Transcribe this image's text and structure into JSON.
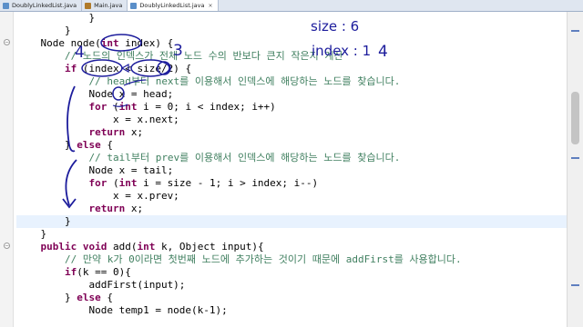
{
  "tabs": [
    {
      "label": "DoublyLinkedList.java",
      "active": false
    },
    {
      "label": "Main.java",
      "active": false
    },
    {
      "label": "DoublyLinkedList.java",
      "active": true
    }
  ],
  "close_glyph": "×",
  "code": {
    "l0": "            }",
    "l1a": "        }",
    "l2_pre": "    Node node(",
    "l2_kw": "int",
    "l2_post": " index) {",
    "l3": "        // 노드의 인덱스가 전체 노드 수의 반보다 큰지 작은지 계산",
    "l4_kw": "if",
    "l4_post": " (index < size/2) {",
    "l5": "            // head부터 next를 이용해서 인덱스에 해당하는 노드를 찾습니다.",
    "l6": "            Node x = head;",
    "l7_kw": "for",
    "l7_mid": " (",
    "l7_kw2": "int",
    "l7_post": " i = 0; i < index; i++)",
    "l8": "                x = x.next;",
    "l9_kw": "return",
    "l9_post": " x;",
    "l10_pre": "        } ",
    "l10_kw": "else",
    "l10_post": " {",
    "l11": "            // tail부터 prev를 이용해서 인덱스에 해당하는 노드를 찾습니다.",
    "l12": "            Node x = tail;",
    "l13_kw": "for",
    "l13_mid": " (",
    "l13_kw2": "int",
    "l13_post": " i = size - 1; i > index; i--)",
    "l14": "                x = x.prev;",
    "l15_kw": "return",
    "l15_post": " x;",
    "l16": "        }",
    "l17": "    }",
    "l18_kw1": "public",
    "l18_kw2": "void",
    "l18_mid": " add(",
    "l18_kw3": "int",
    "l18_post": " k, Object input){",
    "l19": "        // 만약 k가 0이라면 첫번째 노드에 추가하는 것이기 때문에 addFirst를 사용합니다.",
    "l20_kw": "if",
    "l20_post": "(k == 0){",
    "l21": "            addFirst(input);",
    "l22_pre": "        } ",
    "l22_kw": "else",
    "l22_post": " {",
    "l23": "            Node temp1 = node(k-1);"
  },
  "annotations": {
    "size_note": "size : 6",
    "index_note": "index : 1",
    "four_right": "4",
    "four_left": "4",
    "three": "3"
  }
}
